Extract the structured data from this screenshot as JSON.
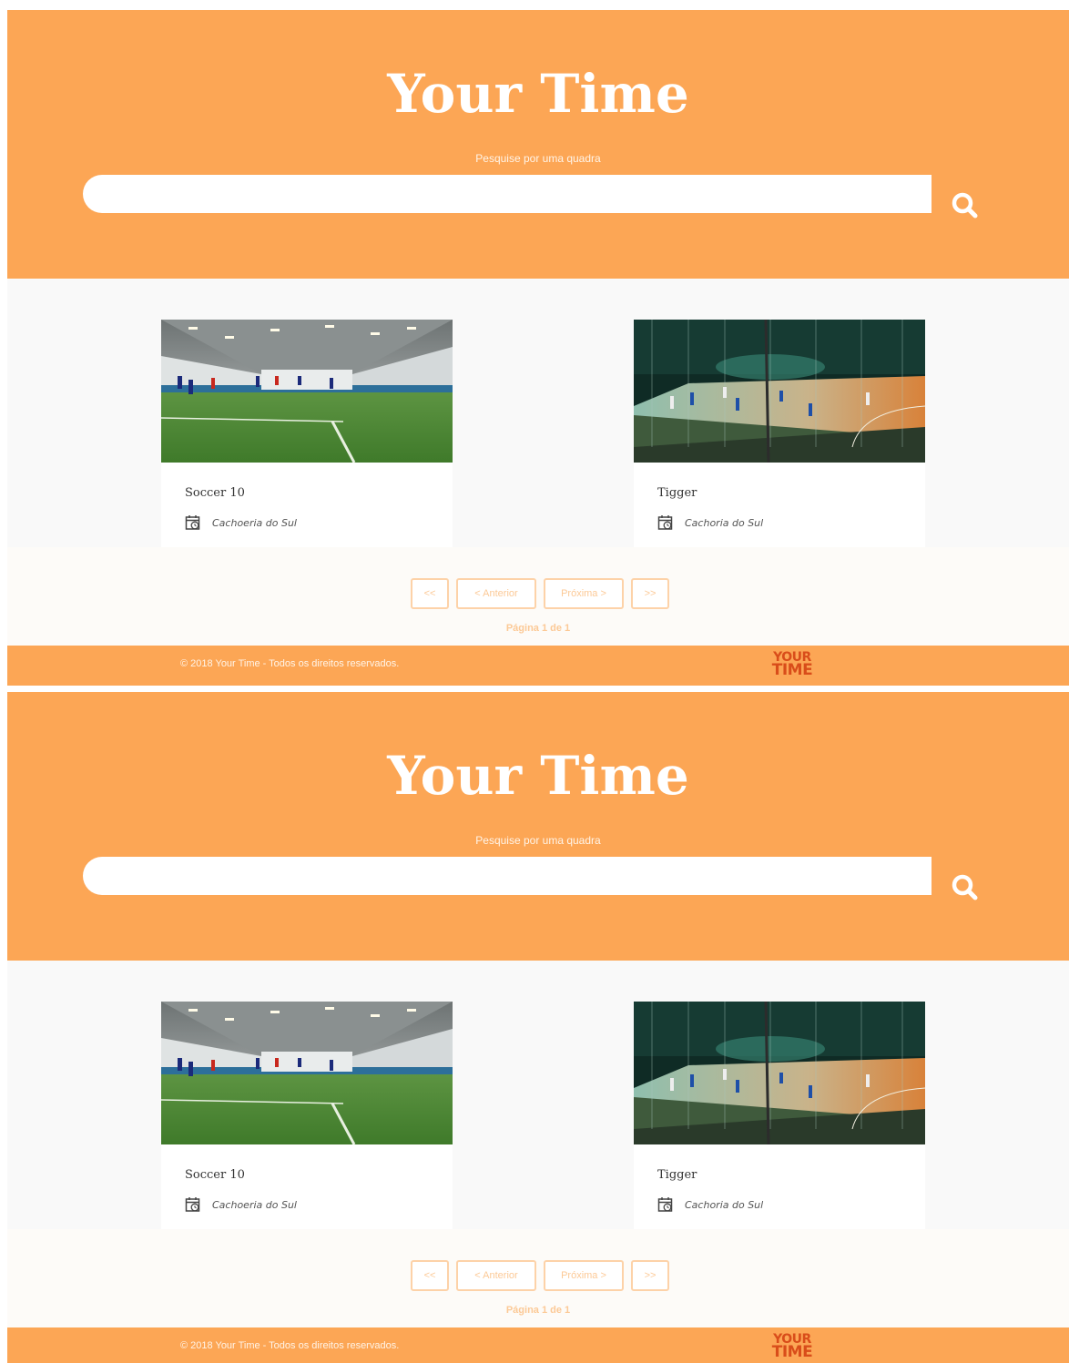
{
  "header": {
    "title": "Your Time",
    "search_label": "Pesquise por uma quadra",
    "search_value": "",
    "search_icon": "search-icon"
  },
  "courts": [
    {
      "name": "Soccer 10",
      "location": "Cachoeria do Sul",
      "icon": "calendar-icon"
    },
    {
      "name": "Tigger",
      "location": "Cachoria do Sul",
      "icon": "calendar-icon"
    }
  ],
  "pagination": {
    "first": "<<",
    "prev": "< Anterior",
    "next": "Próxima >",
    "last": ">>",
    "info": "Página 1 de 1"
  },
  "footer": {
    "copyright": "© 2018 Your Time - Todos os direitos reservados.",
    "logo_line1": "YOUR",
    "logo_line2": "TIME"
  },
  "colors": {
    "brand_orange": "#fca655",
    "logo_red": "#d94d1a",
    "pager_border": "#fdd2a8"
  }
}
